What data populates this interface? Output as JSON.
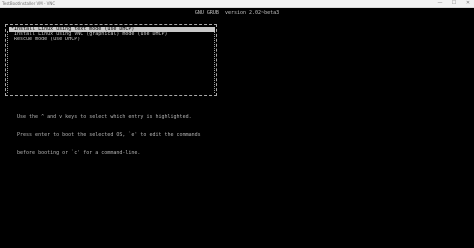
{
  "window": {
    "title": "TestBootInstaller VM - VNC",
    "controls": [
      "—",
      "☐",
      "✕"
    ]
  },
  "grub": {
    "header": "GNU GRUB  version 2.02~beta3",
    "menu_items": [
      {
        "label": "*Install Linux using text mode (use DHCP)",
        "selected": true
      },
      {
        "label": " Install Linux using VNC (graphical) mode (use DHCP)",
        "selected": false
      },
      {
        "label": " Rescue mode (use DHCP)",
        "selected": false
      }
    ],
    "help_lines": [
      "Use the ^ and v keys to select which entry is highlighted.",
      "Press enter to boot the selected OS, `e' to edit the commands",
      "before booting or `c' for a command-line."
    ]
  },
  "colors": {
    "background": "#000000",
    "text": "#c8c8c8",
    "highlight_bg": "#c8c8c8",
    "highlight_fg": "#000000"
  }
}
